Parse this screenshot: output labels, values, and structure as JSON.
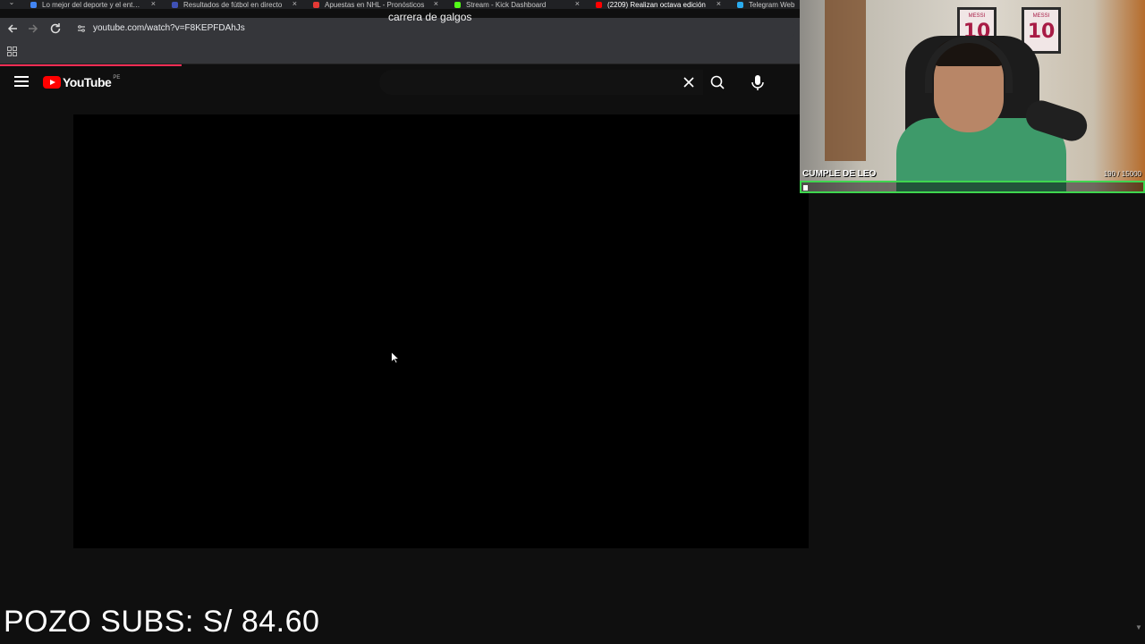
{
  "browser": {
    "tabs": [
      {
        "title": "Lo mejor del deporte y el entretenimiento",
        "color": "#4285f4"
      },
      {
        "title": "Resultados de fútbol en directo",
        "color": "#3f51b5"
      },
      {
        "title": "Apuestas en NHL - Pronósticos",
        "color": "#e53935"
      },
      {
        "title": "Stream - Kick Dashboard",
        "color": "#53fc18"
      },
      {
        "title": "(2209) Realizan octava edición",
        "color": "#ff0000"
      },
      {
        "title": "Telegram Web",
        "color": "#2aabee"
      }
    ],
    "tab_close_glyph": "×",
    "url": "youtube.com/watch?v=F8KEPFDAhJs"
  },
  "youtube": {
    "logo_text": "YouTube",
    "region": "PE",
    "search_value": "carrera de galgos"
  },
  "webcam": {
    "goal_label": "CUMPLE DE LEO",
    "goal_count": "190 / 15000",
    "goal_progress": 0.0127,
    "jersey_name": "MESSI",
    "jersey_number": "10"
  },
  "overlay": {
    "pozo_text": "POZO SUBS: S/ 84.60"
  }
}
